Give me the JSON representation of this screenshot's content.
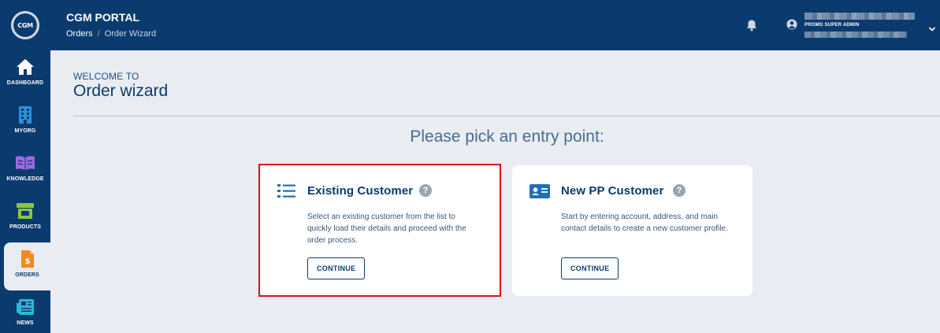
{
  "app": {
    "logo_text": "CGM",
    "title": "CGM PORTAL"
  },
  "breadcrumb": {
    "link": "Orders",
    "separator": "/",
    "current": "Order Wizard"
  },
  "sidebar": {
    "items": [
      {
        "label": "DASHBOARD",
        "icon": "home-icon"
      },
      {
        "label": "MYORG",
        "icon": "building-icon"
      },
      {
        "label": "KNOWLEDGE",
        "icon": "book-icon"
      },
      {
        "label": "PRODUCTS",
        "icon": "store-icon"
      },
      {
        "label": "ORDERS",
        "icon": "invoice-icon",
        "active": true
      },
      {
        "label": "NEWS",
        "icon": "newspaper-icon"
      }
    ]
  },
  "user": {
    "role": "PROMO SUPER ADMIN"
  },
  "main": {
    "welcome": "WELCOME TO",
    "title": "Order wizard",
    "prompt": "Please pick an entry point:"
  },
  "cards": [
    {
      "title": "Existing Customer",
      "description": "Select an existing customer from the list to quickly load their details and proceed with the order process.",
      "button": "CONTINUE",
      "icon": "list-icon"
    },
    {
      "title": "New PP Customer",
      "description": "Start by entering account, address, and main contact details to create a new customer profile.",
      "button": "CONTINUE",
      "icon": "id-card-icon"
    }
  ],
  "colors": {
    "brand": "#0b3a6e",
    "background": "#e9edf1",
    "highlight": "#d9141b",
    "dashboard_icon": "#ffffff",
    "myorg_icon": "#2f8fd8",
    "knowledge_icon": "#a067e0",
    "products_icon": "#8dc63f",
    "orders_icon": "#f08a1c",
    "news_icon": "#2fb7d6"
  }
}
